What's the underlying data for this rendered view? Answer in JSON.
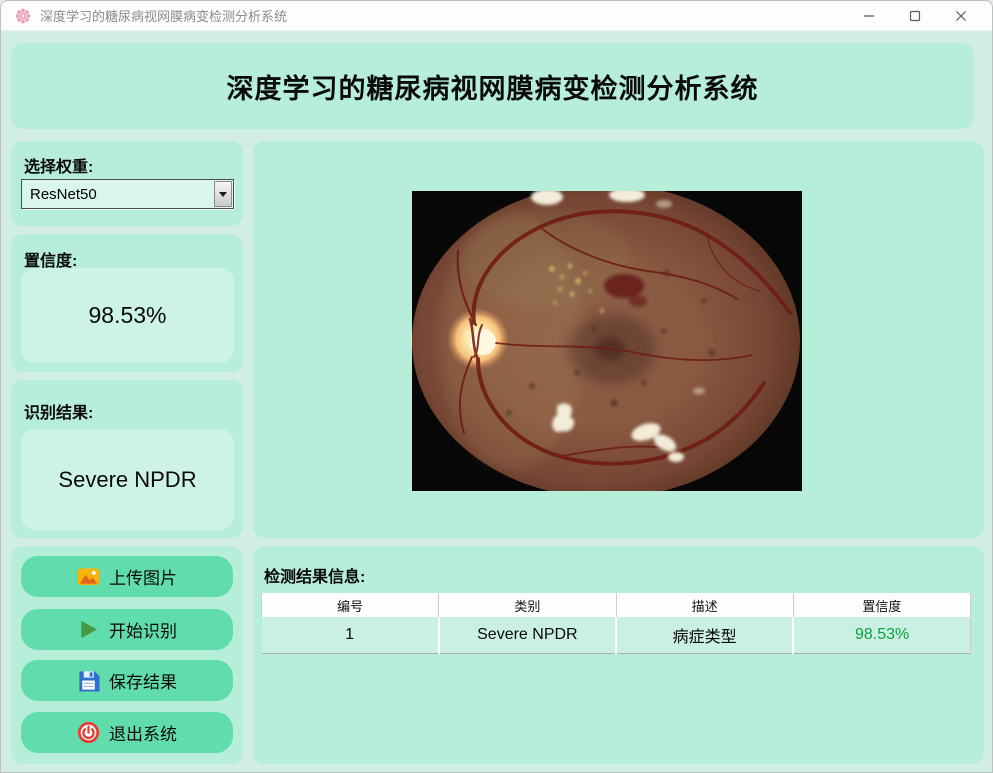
{
  "window": {
    "titlebar": {
      "title": "深度学习的糖尿病视网膜病变检测分析系统",
      "icons": {
        "app": "pink-flower-icon",
        "minimize": "minimize-icon",
        "maximize": "maximize-icon",
        "close": "close-icon"
      }
    }
  },
  "header": {
    "title": "深度学习的糖尿病视网膜病变检测分析系统"
  },
  "sidebar": {
    "weight": {
      "label": "选择权重:",
      "selected": "ResNet50"
    },
    "confidence": {
      "label": "置信度:",
      "value": "98.53%"
    },
    "result": {
      "label": "识别结果:",
      "value": "Severe NPDR"
    },
    "actions": {
      "upload": {
        "label": "上传图片",
        "icon": "image-icon"
      },
      "start": {
        "label": "开始识别",
        "icon": "play-icon"
      },
      "save": {
        "label": "保存结果",
        "icon": "floppy-save-icon"
      },
      "exit": {
        "label": "退出系统",
        "icon": "power-icon"
      }
    }
  },
  "main": {
    "image": "retina-fundus-photograph"
  },
  "results": {
    "label": "检测结果信息:",
    "table": {
      "headers": [
        "编号",
        "类别",
        "描述",
        "置信度"
      ],
      "row": {
        "id": "1",
        "category": "Severe NPDR",
        "description": "病症类型",
        "confidence": "98.53%"
      }
    }
  },
  "colors": {
    "panel": "#b7eeda",
    "background": "#d2ede1",
    "inner_box": "#cdf3e6",
    "button": "#61dcac",
    "confidence_green": "#0ca23e"
  }
}
